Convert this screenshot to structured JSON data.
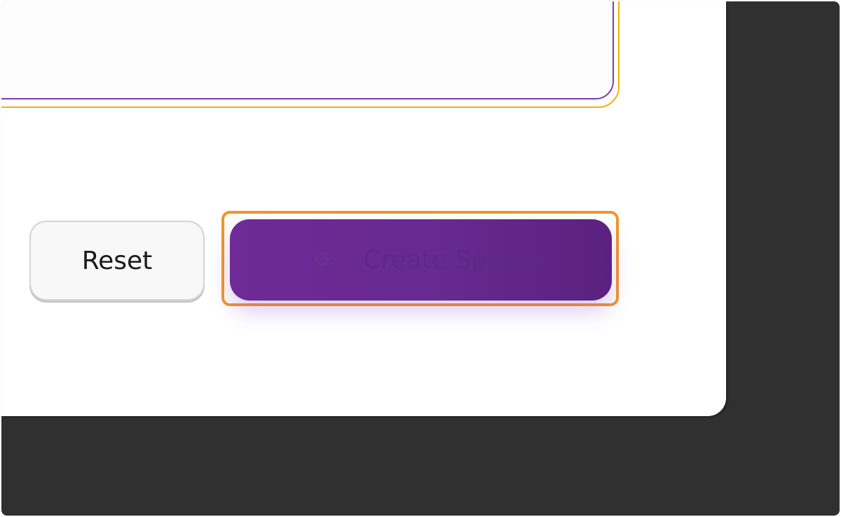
{
  "form": {
    "description_value": "",
    "reset_label": "Reset",
    "create_label": "Create Space",
    "create_icon": "loader-icon"
  },
  "colors": {
    "primary": "#6e2a96",
    "focus_ring": "#f5b400",
    "highlight": "#f0952a",
    "backdrop": "#303030"
  }
}
